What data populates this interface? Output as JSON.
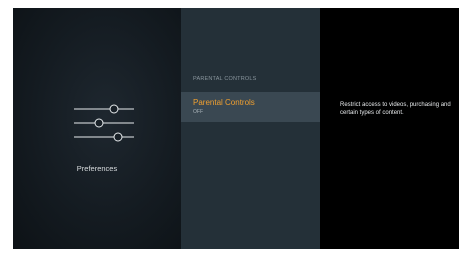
{
  "left_panel": {
    "icon": "sliders-icon",
    "label": "Preferences"
  },
  "middle_panel": {
    "section_header": "PARENTAL CONTROLS",
    "items": [
      {
        "title": "Parental Controls",
        "value": "OFF",
        "selected": true,
        "title_color": "#f0a030"
      }
    ]
  },
  "right_panel": {
    "description": "Restrict access to videos, purchasing and certain types of content."
  }
}
